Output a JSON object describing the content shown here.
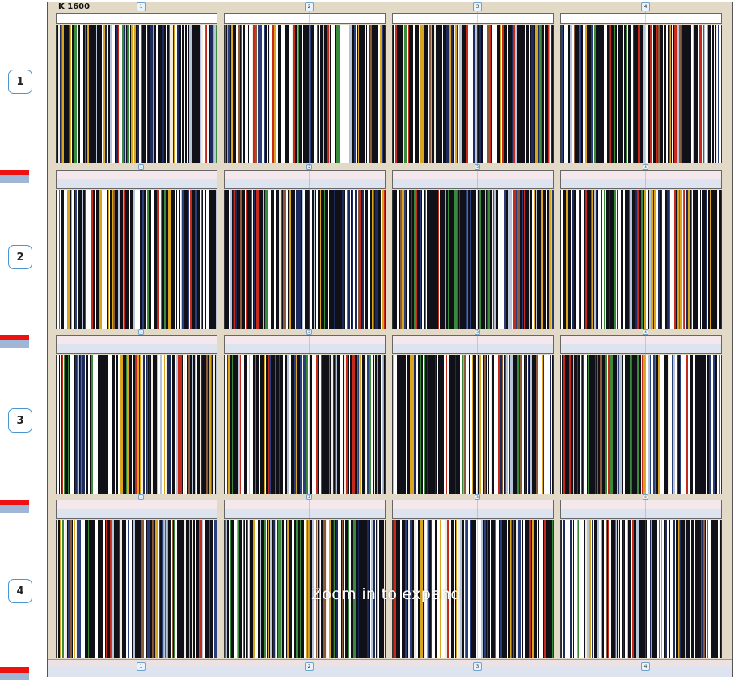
{
  "title": "K 1600",
  "zoom_hint": "Zoom in to expand",
  "rows": [
    {
      "label": "1"
    },
    {
      "label": "2"
    },
    {
      "label": "3"
    },
    {
      "label": "4"
    }
  ],
  "columns": [
    {
      "label": "1"
    },
    {
      "label": "2"
    },
    {
      "label": "3"
    },
    {
      "label": "4"
    }
  ],
  "colors": {
    "frame_background": "#e2dac6",
    "row_badge_border": "#4a95d0",
    "separator_red": "#ee1111",
    "separator_blue": "#9fb6d6",
    "bar_palette": [
      "#101018",
      "#ffffff",
      "#1c2a5c",
      "#2a3f7a",
      "#c62a1a",
      "#d9a520",
      "#3b8a3b",
      "#8a5a3a",
      "#b8c4d8",
      "#f2ece0"
    ]
  },
  "icons": {
    "row_badge": "numbered-rounded-badge",
    "col_badge": "numbered-square-badge"
  }
}
